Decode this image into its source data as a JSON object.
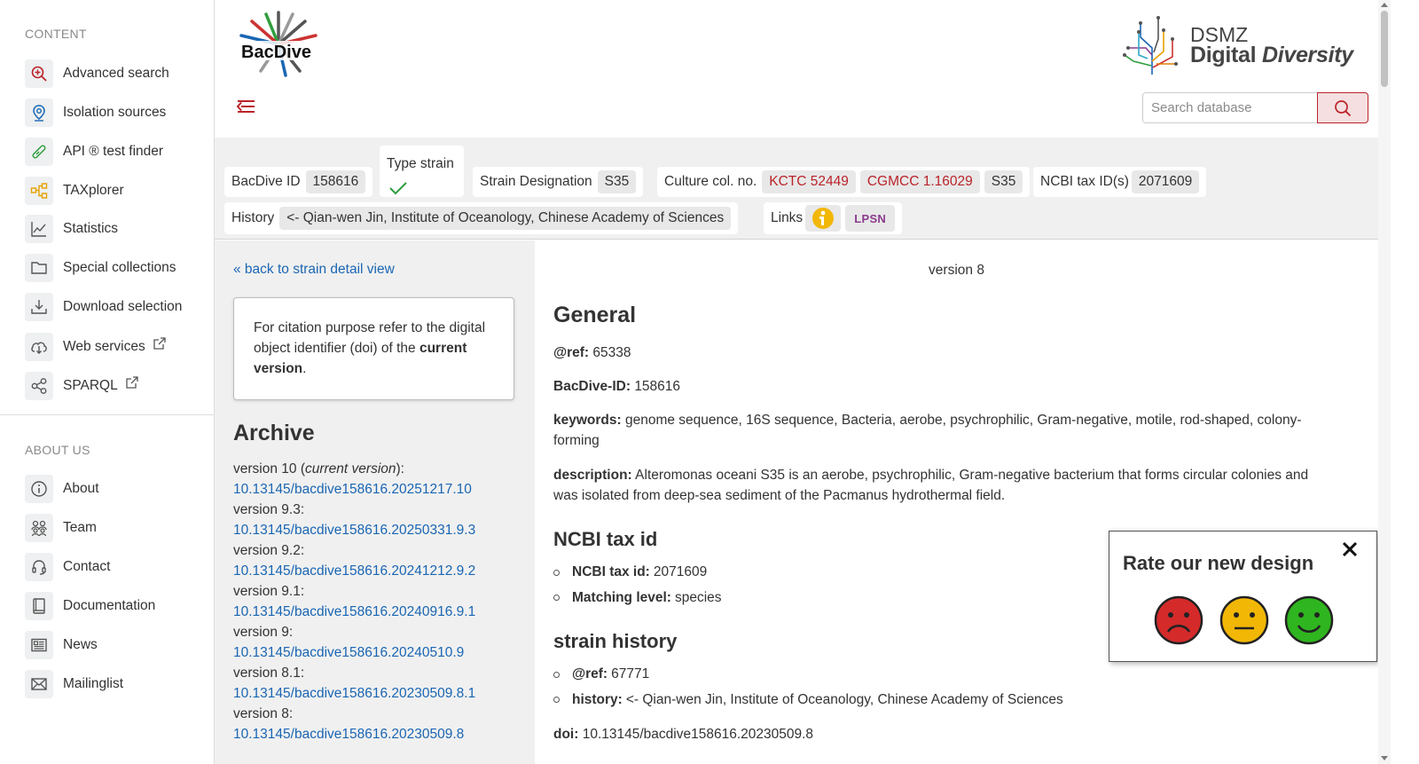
{
  "sidebar": {
    "content_heading": "CONTENT",
    "content_items": [
      {
        "label": "Advanced search",
        "icon": "search-plus-icon"
      },
      {
        "label": "Isolation sources",
        "icon": "map-pin-icon"
      },
      {
        "label": "API ® test finder",
        "icon": "test-tube-icon"
      },
      {
        "label": "TAXplorer",
        "icon": "hierarchy-icon"
      },
      {
        "label": "Statistics",
        "icon": "line-chart-icon"
      },
      {
        "label": "Special collections",
        "icon": "folder-icon"
      },
      {
        "label": "Download selection",
        "icon": "download-icon"
      },
      {
        "label": "Web services",
        "icon": "cloud-download-icon",
        "external": true
      },
      {
        "label": "SPARQL",
        "icon": "share-nodes-icon",
        "external": true
      }
    ],
    "about_heading": "ABOUT US",
    "about_items": [
      {
        "label": "About",
        "icon": "info-icon"
      },
      {
        "label": "Team",
        "icon": "team-icon"
      },
      {
        "label": "Contact",
        "icon": "headset-icon"
      },
      {
        "label": "Documentation",
        "icon": "book-icon"
      },
      {
        "label": "News",
        "icon": "newspaper-icon"
      },
      {
        "label": "Mailinglist",
        "icon": "envelope-icon"
      }
    ]
  },
  "header": {
    "logo_text": "BacDive",
    "dsmz_line1": "DSMZ",
    "dsmz_line2a": "Digital ",
    "dsmz_line2b": "Diversity",
    "search_placeholder": "Search database",
    "accent_color": "#ba2329"
  },
  "infobar": {
    "bacdive_id_label": "BacDive ID",
    "bacdive_id": "158616",
    "type_strain_label": "Type strain",
    "strain_designation_label": "Strain Designation",
    "strain_designation": "S35",
    "culture_label": "Culture col. no.",
    "culture_numbers": [
      "KCTC 52449",
      "CGMCC 1.16029",
      "S35"
    ],
    "ncbi_label": "NCBI tax ID(s)",
    "ncbi_id": "2071609",
    "history_label": "History",
    "history": "<- Qian-wen Jin, Institute of Oceanology, Chinese Academy of Sciences",
    "links_label": "Links",
    "lpsn_label": "LPSN"
  },
  "left": {
    "back_link": "« back to strain detail view",
    "cite_text": "For citation purpose refer to the digital object identifier (doi) of the ",
    "cite_bold": "current version",
    "cite_end": ".",
    "archive_title": "Archive",
    "archive": [
      {
        "version": "version 10 (",
        "current": "current version",
        "suffix": "):",
        "doi": "10.13145/bacdive158616.20251217.10"
      },
      {
        "version": "version 9.3:",
        "doi": "10.13145/bacdive158616.20250331.9.3"
      },
      {
        "version": "version 9.2:",
        "doi": "10.13145/bacdive158616.20241212.9.2"
      },
      {
        "version": "version 9.1:",
        "doi": "10.13145/bacdive158616.20240916.9.1"
      },
      {
        "version": "version 9:",
        "doi": "10.13145/bacdive158616.20240510.9"
      },
      {
        "version": "version 8.1:",
        "doi": "10.13145/bacdive158616.20230509.8.1"
      },
      {
        "version": "version 8:",
        "doi": "10.13145/bacdive158616.20230509.8"
      }
    ]
  },
  "main": {
    "version_label": "version 8",
    "general_title": "General",
    "ref_label": "@ref:",
    "ref_value": "65338",
    "bacdive_id_label": "BacDive-ID:",
    "bacdive_id_value": "158616",
    "keywords_label": "keywords:",
    "keywords_line1": "genome sequence, 16S sequence, Bacteria, aerobe, psychrophilic, Gram-negative, motile, rod-shaped, colony-",
    "keywords_line2": "forming",
    "description_label": "description:",
    "description_line1": "Alteromonas oceani S35 is an aerobe, psychrophilic, Gram-negative bacterium that forms circular colonies and",
    "description_line2": "was isolated from deep-sea sediment of the Pacmanus hydrothermal field.",
    "ncbi_title": "NCBI tax id",
    "ncbi_items": [
      {
        "label": "NCBI tax id:",
        "value": "2071609"
      },
      {
        "label": "Matching level:",
        "value": "species"
      }
    ],
    "history_title": "strain history",
    "history_items": [
      {
        "label": "@ref:",
        "value": "67771"
      },
      {
        "label": "history:",
        "value": "<- Qian-wen Jin, Institute of Oceanology, Chinese Academy of Sciences"
      }
    ],
    "doi_label": "doi:",
    "doi_value": "10.13145/bacdive158616.20230509.8"
  },
  "rating": {
    "title": "Rate our new design",
    "faces": [
      "sad-face-icon",
      "neutral-face-icon",
      "happy-face-icon"
    ]
  }
}
